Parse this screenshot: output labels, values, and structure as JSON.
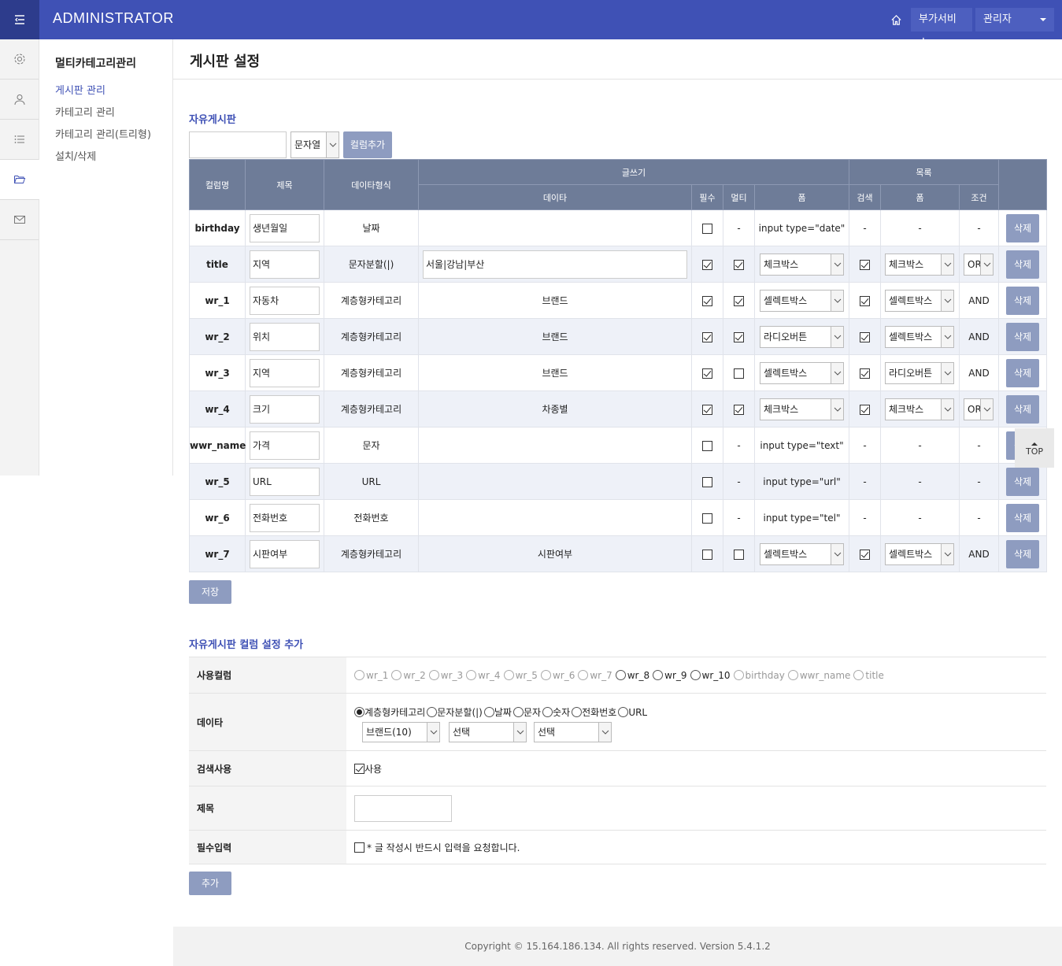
{
  "header": {
    "brand": "ADMINISTRATOR",
    "extra_service": "부가서비스",
    "admin_label": "관리자"
  },
  "submenu": {
    "title": "멀티카테고리관리",
    "items": [
      "게시판 관리",
      "카테고리 관리",
      "카테고리 관리(트리형)",
      "설치/삭제"
    ]
  },
  "page": {
    "title": "게시판 설정",
    "board_name": "자유게시판",
    "type_select": "문자열",
    "add_column_btn": "컬럼추가",
    "save_btn": "저장",
    "add_section_title": "자유게시판 컬럼 설정 추가",
    "add_btn": "추가",
    "top_btn": "TOP"
  },
  "table": {
    "headers": {
      "column": "컬럼명",
      "title": "제목",
      "datatype": "데이타형식",
      "write": "글쓰기",
      "data": "데이타",
      "required": "필수",
      "multi": "멀티",
      "form": "폼",
      "list": "목록",
      "search": "검색",
      "list_form": "폼",
      "cond": "조건"
    },
    "delete_label": "삭제",
    "rows": [
      {
        "col": "birthday",
        "title": "생년월일",
        "type": "날짜",
        "data": "",
        "required": false,
        "multi": "-",
        "form": "input type=\"date\"",
        "search": "-",
        "list_form": "-",
        "cond": "-"
      },
      {
        "col": "title",
        "title": "지역",
        "type": "문자분할(|)",
        "data_input": "서울|강남|부산",
        "required": true,
        "multi": true,
        "form_sel": "체크박스",
        "search": true,
        "list_form_sel": "체크박스",
        "cond_sel": "OR"
      },
      {
        "col": "wr_1",
        "title": "자동차",
        "type": "계층형카테고리",
        "data": "브랜드",
        "required": true,
        "multi": true,
        "form_sel": "셀렉트박스",
        "search": true,
        "list_form_sel": "셀렉트박스",
        "cond": "AND"
      },
      {
        "col": "wr_2",
        "title": "위치",
        "type": "계층형카테고리",
        "data": "브랜드",
        "required": true,
        "multi": true,
        "form_sel": "라디오버튼",
        "search": true,
        "list_form_sel": "셀렉트박스",
        "cond": "AND"
      },
      {
        "col": "wr_3",
        "title": "지역",
        "type": "계층형카테고리",
        "data": "브랜드",
        "required": true,
        "multi": false,
        "form_sel": "셀렉트박스",
        "search": true,
        "list_form_sel": "라디오버튼",
        "cond": "AND"
      },
      {
        "col": "wr_4",
        "title": "크기",
        "type": "계층형카테고리",
        "data": "차종별",
        "required": true,
        "multi": true,
        "form_sel": "체크박스",
        "search": true,
        "list_form_sel": "체크박스",
        "cond_sel": "OR"
      },
      {
        "col": "wwr_name",
        "title": "가격",
        "type": "문자",
        "data": "",
        "required": false,
        "multi": "-",
        "form": "input type=\"text\"",
        "search": "-",
        "list_form": "-",
        "cond": "-"
      },
      {
        "col": "wr_5",
        "title": "URL",
        "type": "URL",
        "data": "",
        "required": false,
        "multi": "-",
        "form": "input type=\"url\"",
        "search": "-",
        "list_form": "-",
        "cond": "-"
      },
      {
        "col": "wr_6",
        "title": "전화번호",
        "type": "전화번호",
        "data": "",
        "required": false,
        "multi": "-",
        "form": "input type=\"tel\"",
        "search": "-",
        "list_form": "-",
        "cond": "-"
      },
      {
        "col": "wr_7",
        "title": "시판여부",
        "type": "계층형카테고리",
        "data": "시판여부",
        "required": false,
        "multi": false,
        "form_sel": "셀렉트박스",
        "search": true,
        "list_form_sel": "셀렉트박스",
        "cond": "AND"
      }
    ]
  },
  "form": {
    "use_column_label": "사용컬럼",
    "use_columns": [
      {
        "name": "wr_1",
        "enabled": false
      },
      {
        "name": "wr_2",
        "enabled": false
      },
      {
        "name": "wr_3",
        "enabled": false
      },
      {
        "name": "wr_4",
        "enabled": false
      },
      {
        "name": "wr_5",
        "enabled": false
      },
      {
        "name": "wr_6",
        "enabled": false
      },
      {
        "name": "wr_7",
        "enabled": false
      },
      {
        "name": "wr_8",
        "enabled": true
      },
      {
        "name": "wr_9",
        "enabled": true
      },
      {
        "name": "wr_10",
        "enabled": true
      },
      {
        "name": "birthday",
        "enabled": false
      },
      {
        "name": "wwr_name",
        "enabled": false
      },
      {
        "name": "title",
        "enabled": false
      }
    ],
    "data_label": "데이타",
    "data_types": [
      "계층형카테고리",
      "문자분할(|)",
      "날짜",
      "문자",
      "숫자",
      "전화번호",
      "URL"
    ],
    "data_selected": "계층형카테고리",
    "data_selects": [
      "브랜드(10)",
      "선택",
      "선택"
    ],
    "search_label": "검색사용",
    "search_use": "사용",
    "title_label": "제목",
    "required_label": "필수입력",
    "required_text": "* 글 작성시 반드시 입력을 요청합니다."
  },
  "footer": {
    "copyright": "Copyright © 15.164.186.134. All rights reserved. Version 5.4.1.2"
  }
}
